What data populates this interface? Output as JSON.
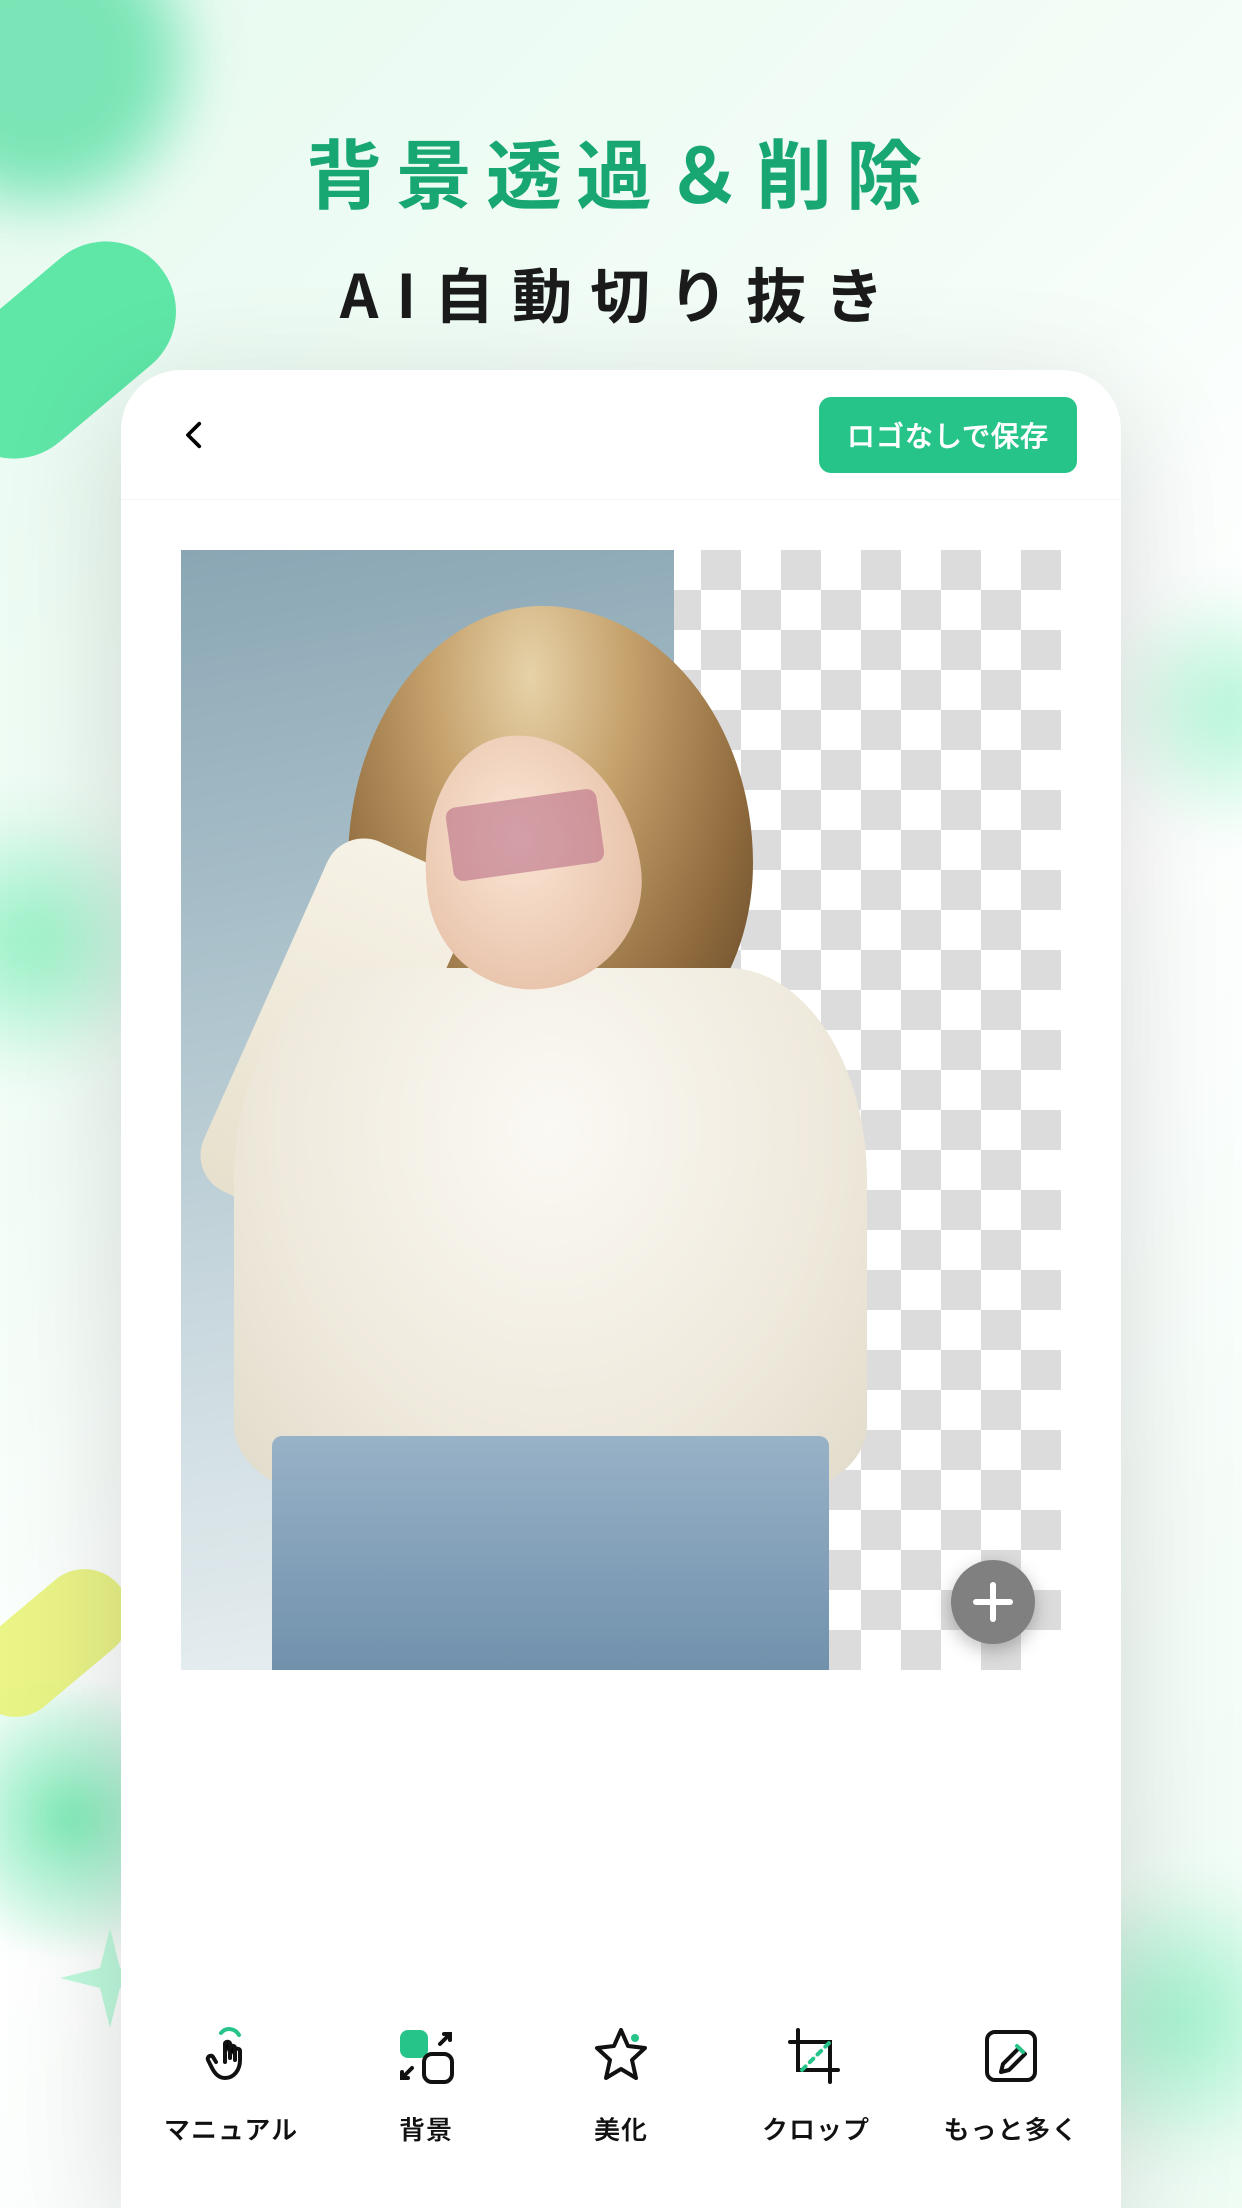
{
  "promo": {
    "title": "背景透過＆削除",
    "subtitle": "AI自動切り抜き"
  },
  "app": {
    "save_label": "ロゴなしで保存"
  },
  "tools": [
    {
      "id": "manual",
      "label": "マニュアル"
    },
    {
      "id": "background",
      "label": "背景"
    },
    {
      "id": "beautify",
      "label": "美化"
    },
    {
      "id": "crop",
      "label": "クロップ"
    },
    {
      "id": "more",
      "label": "もっと多く"
    }
  ],
  "colors": {
    "accent": "#27c48a",
    "headline": "#18a773"
  }
}
